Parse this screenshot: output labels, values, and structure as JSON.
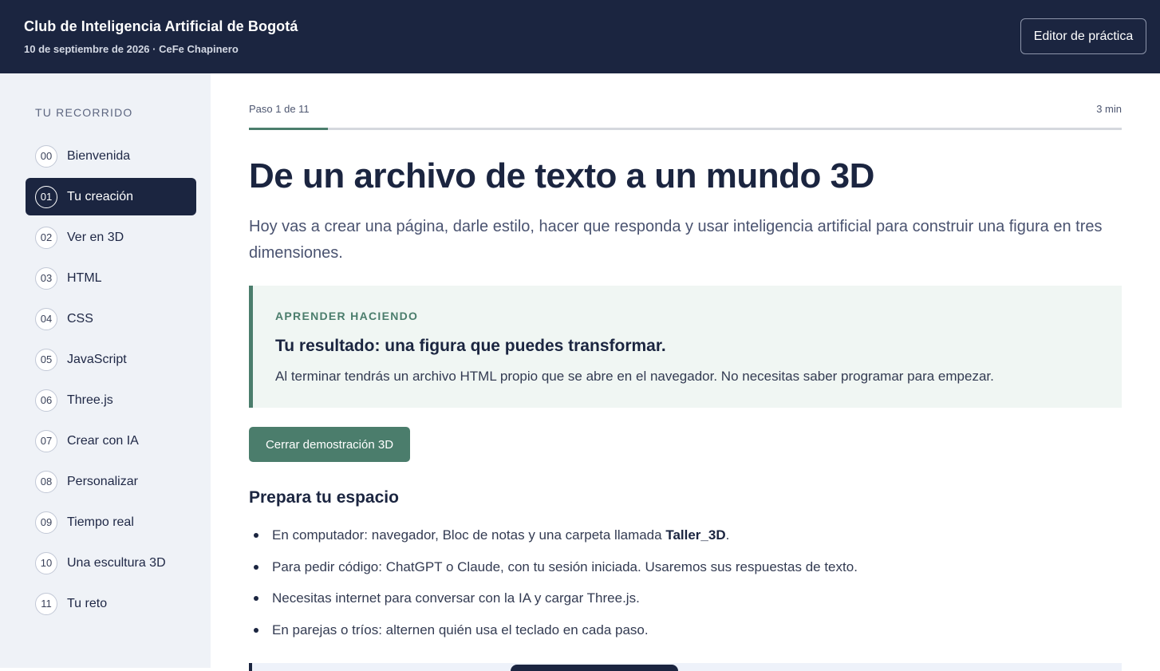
{
  "header": {
    "club_name": "Club de Inteligencia Artificial de Bogotá",
    "subtitle": "10 de septiembre de 2026 · CeFe Chapinero",
    "editor_button": "Editor de práctica"
  },
  "sidebar": {
    "heading": "TU RECORRIDO",
    "active_index": 1,
    "items": [
      {
        "num": "00",
        "label": "Bienvenida"
      },
      {
        "num": "01",
        "label": "Tu creación"
      },
      {
        "num": "02",
        "label": "Ver en 3D"
      },
      {
        "num": "03",
        "label": "HTML"
      },
      {
        "num": "04",
        "label": "CSS"
      },
      {
        "num": "05",
        "label": "JavaScript"
      },
      {
        "num": "06",
        "label": "Three.js"
      },
      {
        "num": "07",
        "label": "Crear con IA"
      },
      {
        "num": "08",
        "label": "Personalizar"
      },
      {
        "num": "09",
        "label": "Tiempo real"
      },
      {
        "num": "10",
        "label": "Una escultura 3D"
      },
      {
        "num": "11",
        "label": "Tu reto"
      }
    ]
  },
  "progress": {
    "step_text": "Paso 1 de 11",
    "duration": "3 min",
    "fraction": 0.0909
  },
  "content": {
    "title": "De un archivo de texto a un mundo 3D",
    "lead": "Hoy vas a crear una página, darle estilo, hacer que responda y usar inteligencia artificial para construir una figura en tres dimensiones.",
    "callout": {
      "kicker": "APRENDER HACIENDO",
      "title": "Tu resultado: una figura que puedes transformar.",
      "body": "Al terminar tendrás un archivo HTML propio que se abre en el navegador. No necesitas saber programar para empezar."
    },
    "demo_button": "Cerrar demostración 3D",
    "section_title": "Prepara tu espacio",
    "bullets": [
      {
        "before": "En computador: navegador, Bloc de notas y una carpeta llamada ",
        "bold": "Taller_3D",
        "after": "."
      },
      {
        "before": "Para pedir código: ChatGPT o Claude, con tu sesión iniciada. Usaremos sus respuestas de texto.",
        "bold": "",
        "after": ""
      },
      {
        "before": "Necesitas internet para conversar con la IA y cargar Three.js.",
        "bold": "",
        "after": ""
      },
      {
        "before": "En parejas o tríos: alternen quién usa el teclado en cada paso.",
        "bold": "",
        "after": ""
      }
    ]
  },
  "colors": {
    "navy": "#1b2540",
    "accent_green": "#4b7d6c",
    "sidebar_bg": "#eff2f7",
    "callout_bg": "#f0f6f3"
  }
}
